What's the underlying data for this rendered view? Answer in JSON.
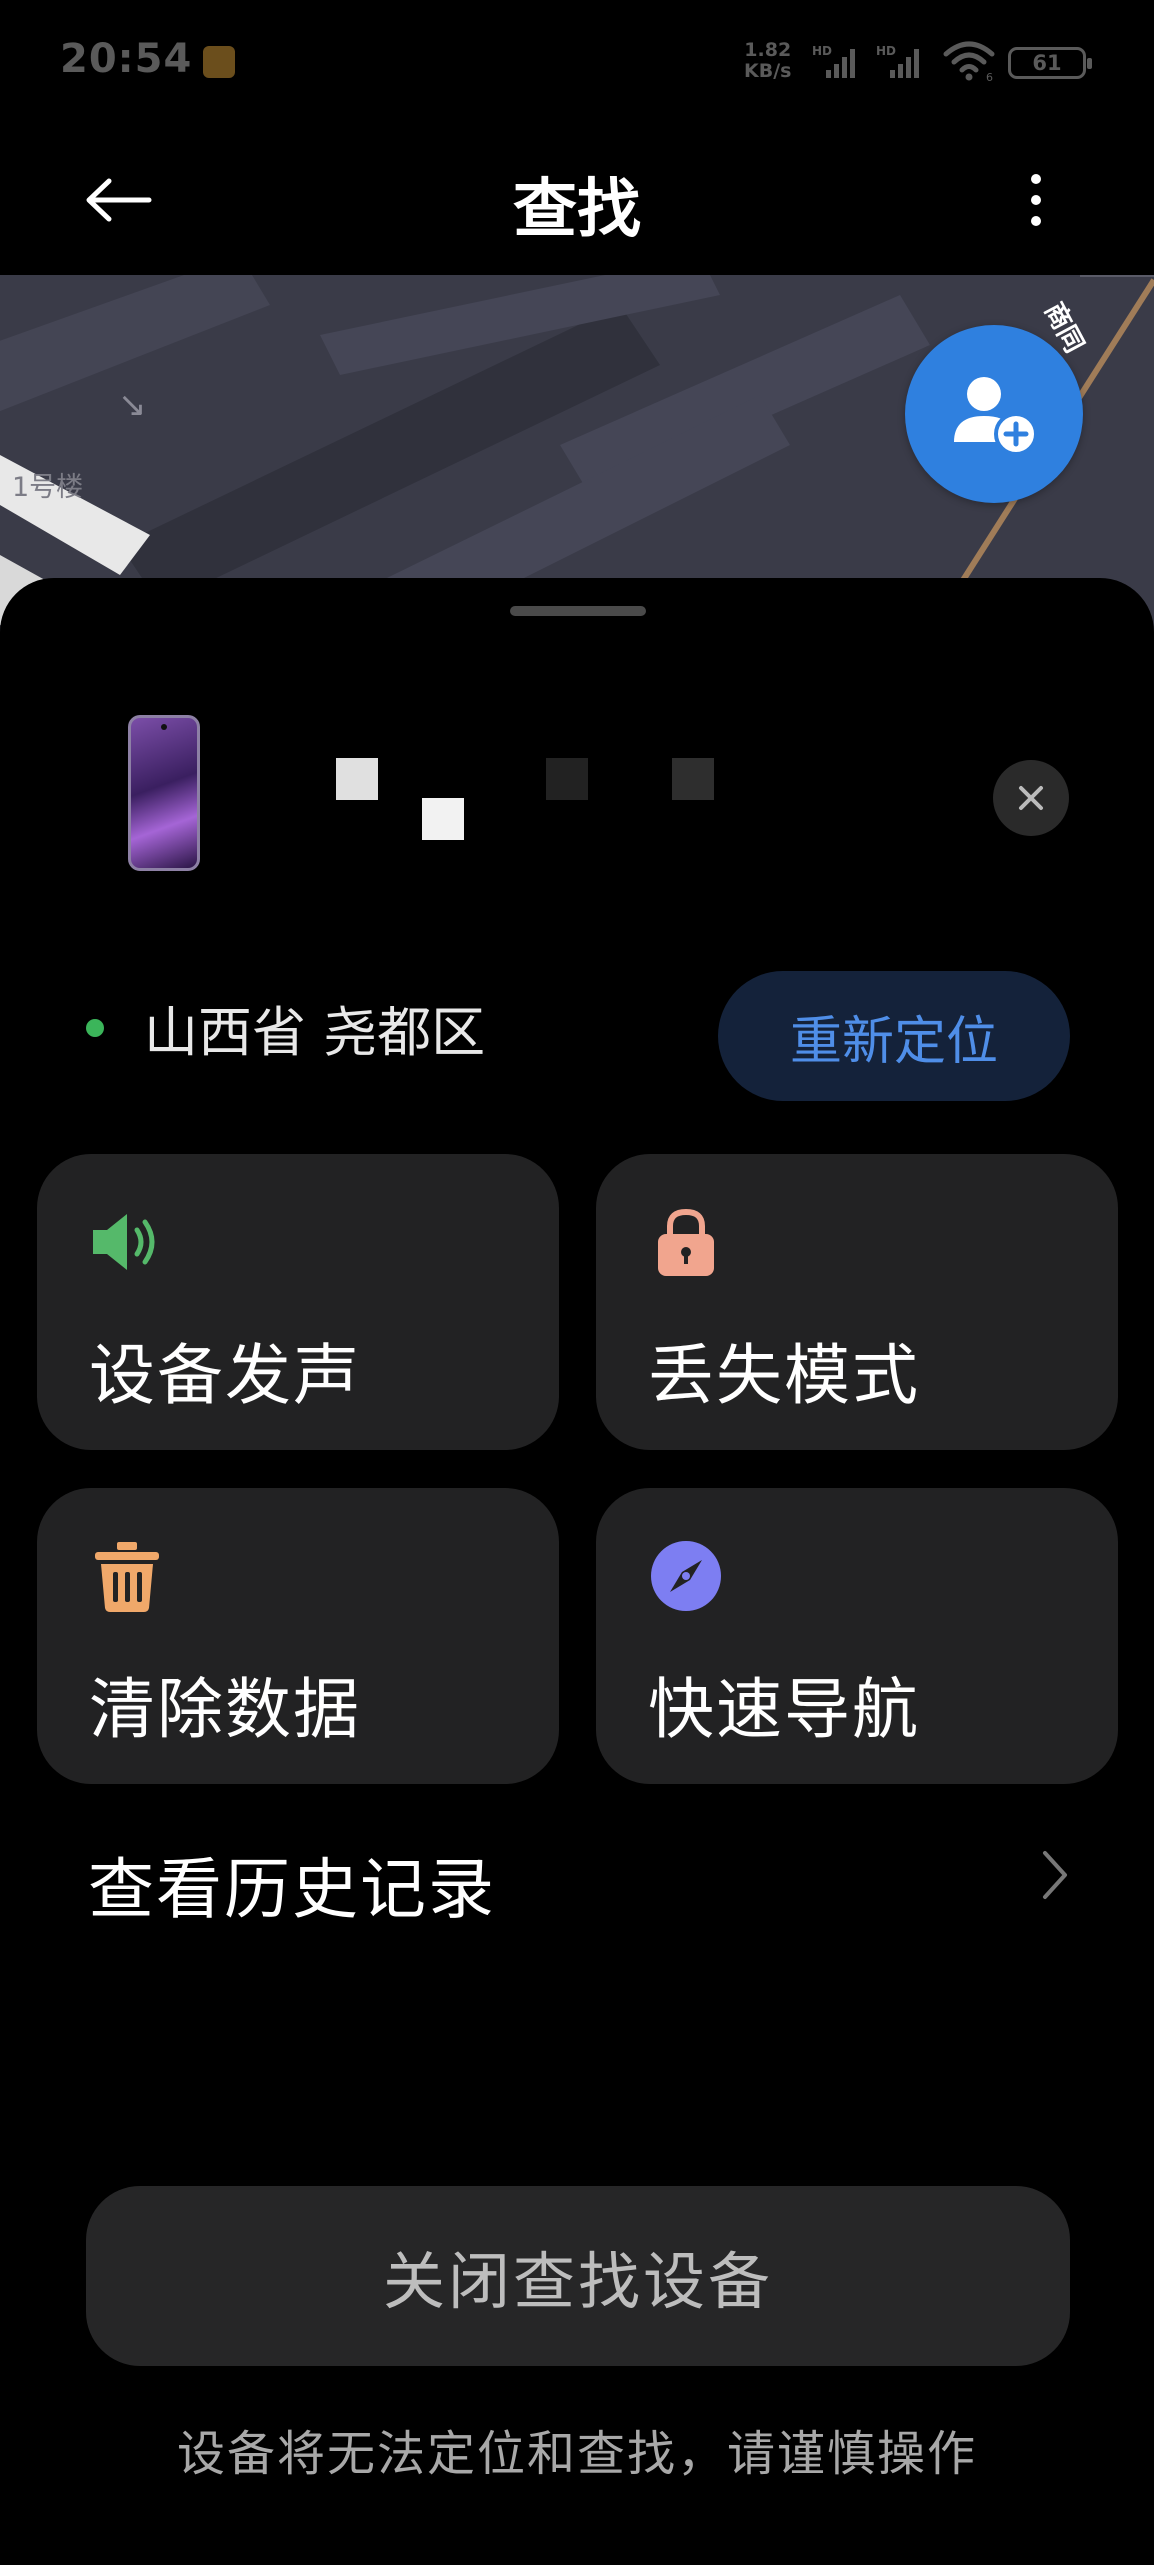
{
  "status_bar": {
    "time": "20:54",
    "network_speed_value": "1.82",
    "network_speed_unit": "KB/s",
    "sim1_label": "HD",
    "sim2_label": "HD",
    "wifi_label": "6",
    "battery": "61"
  },
  "header": {
    "title": "查找"
  },
  "map": {
    "building_label": "1号楼",
    "road_label": "商同"
  },
  "device": {
    "name": "▪ ▪ ▪ ▪"
  },
  "location": {
    "text": "山西省 尧都区",
    "relocate_label": "重新定位"
  },
  "actions": {
    "play_sound": "设备发声",
    "lost_mode": "丢失模式",
    "erase_data": "清除数据",
    "quick_nav": "快速导航"
  },
  "history": {
    "label": "查看历史记录"
  },
  "footer": {
    "disable_label": "关闭查找设备",
    "warning": "设备将无法定位和查找，请谨慎操作"
  },
  "colors": {
    "accent_blue": "#2f80df",
    "status_green": "#3bb55a",
    "sound_icon": "#55b96a",
    "lock_icon": "#f1a58e",
    "trash_icon": "#f0a86a",
    "compass_icon": "#7d7ef2"
  },
  "icons": {
    "back": "arrow-left-icon",
    "more": "more-vertical-icon",
    "add_contact": "person-add-icon",
    "close": "close-icon",
    "sound": "speaker-icon",
    "lock": "lock-icon",
    "trash": "trash-icon",
    "compass": "compass-icon",
    "chevron": "chevron-right-icon"
  }
}
